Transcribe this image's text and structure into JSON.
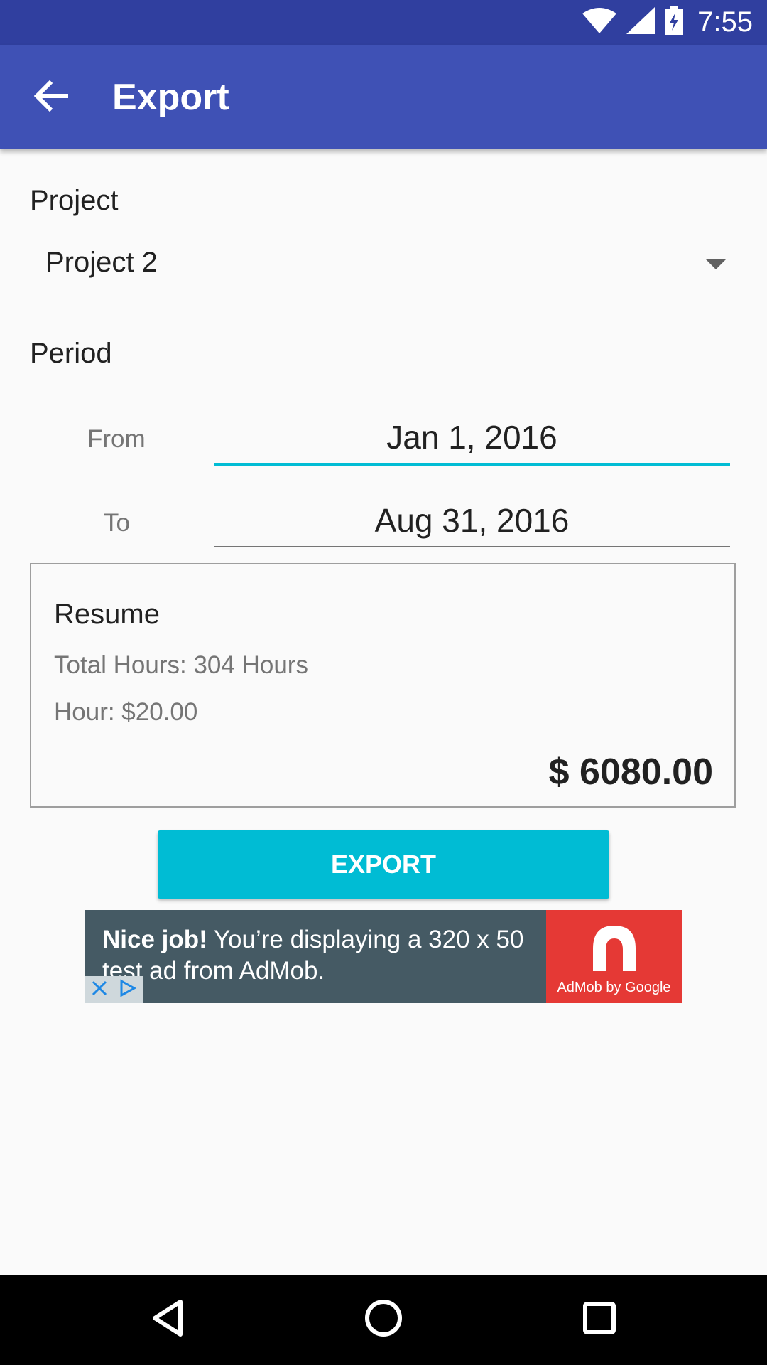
{
  "status_bar": {
    "time": "7:55",
    "icons": [
      "wifi-icon",
      "signal-icon",
      "battery-charging-icon"
    ]
  },
  "app_bar": {
    "title": "Export",
    "back_icon": "arrow-back-icon"
  },
  "project": {
    "label": "Project",
    "selected": "Project 2"
  },
  "period": {
    "label": "Period",
    "from_label": "From",
    "from_value": "Jan 1, 2016",
    "to_label": "To",
    "to_value": "Aug 31, 2016"
  },
  "resume": {
    "title": "Resume",
    "total_hours": "Total Hours: 304 Hours",
    "hour_rate": "Hour: $20.00",
    "total": "$ 6080.00"
  },
  "export_button": {
    "label": "EXPORT"
  },
  "ad": {
    "headline_bold": "Nice job!",
    "headline_rest": " You’re displaying a 320 x 50 test ad from AdMob.",
    "logo_caption": "AdMob by Google"
  },
  "colors": {
    "status_bar": "#303f9f",
    "app_bar": "#3f51b5",
    "accent": "#00bcd4",
    "ad_background": "#455a64",
    "ad_logo": "#e53935"
  }
}
